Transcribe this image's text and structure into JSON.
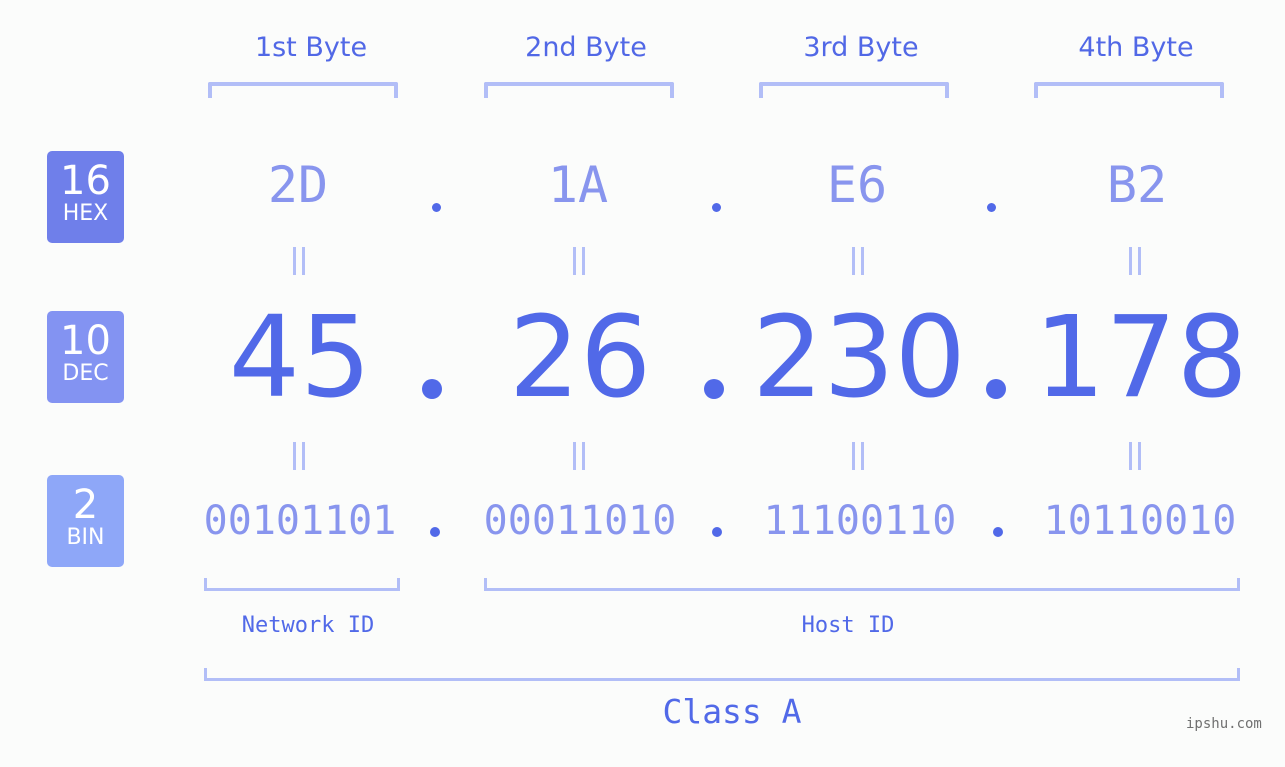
{
  "badges": [
    {
      "number": "16",
      "label": "HEX",
      "color": "#6f7fea"
    },
    {
      "number": "10",
      "label": "DEC",
      "color": "#8393f2"
    },
    {
      "number": "2",
      "label": "BIN",
      "color": "#8ea7f8"
    }
  ],
  "bytes": [
    {
      "label": "1st Byte",
      "hex": "2D",
      "dec": "45",
      "bin": "00101101"
    },
    {
      "label": "2nd Byte",
      "hex": "1A",
      "dec": "26",
      "bin": "00011010"
    },
    {
      "label": "3rd Byte",
      "hex": "E6",
      "dec": "230",
      "bin": "11100110"
    },
    {
      "label": "4th Byte",
      "hex": "B2",
      "dec": "178",
      "bin": "10110010"
    }
  ],
  "network_id_label": "Network ID",
  "host_id_label": "Host ID",
  "class_label": "Class A",
  "watermark": "ipshu.com",
  "colors": {
    "accent": "#5169e8",
    "light_accent": "#8895ee",
    "bracket": "#b2bef7",
    "background": "#fbfcfb"
  }
}
